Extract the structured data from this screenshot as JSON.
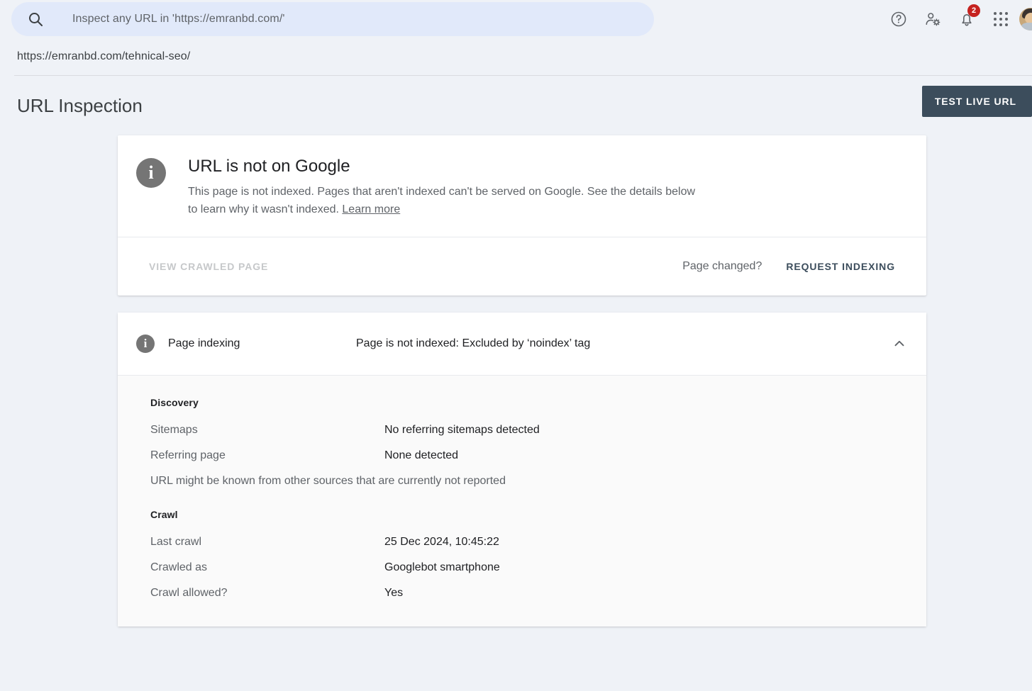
{
  "topbar": {
    "search": {
      "placeholder": "Inspect any URL in 'https://emranbd.com/'",
      "value": "",
      "icon": "search-icon"
    },
    "icons": {
      "help": "help-circle-icon",
      "account_settings": "person-gear-icon",
      "notifications": "bell-icon",
      "apps": "apps-grid-icon",
      "avatar": "user-avatar"
    },
    "notification_count": "2"
  },
  "url_bar": {
    "url": "https://emranbd.com/tehnical-seo/"
  },
  "header": {
    "title": "URL Inspection",
    "test_live_url_label": "TEST LIVE URL"
  },
  "status_card": {
    "icon": "info-icon",
    "icon_letter": "i",
    "title": "URL is not on Google",
    "description": "This page is not indexed. Pages that aren't indexed can't be served on Google. See the details below to learn why it wasn't indexed. ",
    "learn_more_label": "Learn more",
    "actions": {
      "view_crawled_page_label": "VIEW CRAWLED PAGE",
      "page_changed_label": "Page changed?",
      "request_indexing_label": "REQUEST INDEXING"
    }
  },
  "page_indexing": {
    "icon": "info-icon",
    "icon_letter": "i",
    "label": "Page indexing",
    "value": "Page is not indexed: Excluded by ‘noindex’ tag",
    "chevron": "chevron-up-icon",
    "groups": [
      {
        "title": "Discovery",
        "rows": [
          {
            "key": "Sitemaps",
            "value": "No referring sitemaps detected"
          },
          {
            "key": "Referring page",
            "value": "None detected"
          }
        ],
        "note": "URL might be known from other sources that are currently not reported"
      },
      {
        "title": "Crawl",
        "rows": [
          {
            "key": "Last crawl",
            "value": "25 Dec 2024, 10:45:22"
          },
          {
            "key": "Crawled as",
            "value": "Googlebot smartphone"
          },
          {
            "key": "Crawl allowed?",
            "value": "Yes"
          }
        ]
      }
    ]
  },
  "colors": {
    "page_background": "#eff2f7",
    "search_background": "#e1e9fa",
    "button_primary": "#3c4d5c",
    "badge_red": "#c5221f",
    "info_gray": "#757575",
    "card_white": "#ffffff",
    "panel_gray": "#fafafa"
  }
}
